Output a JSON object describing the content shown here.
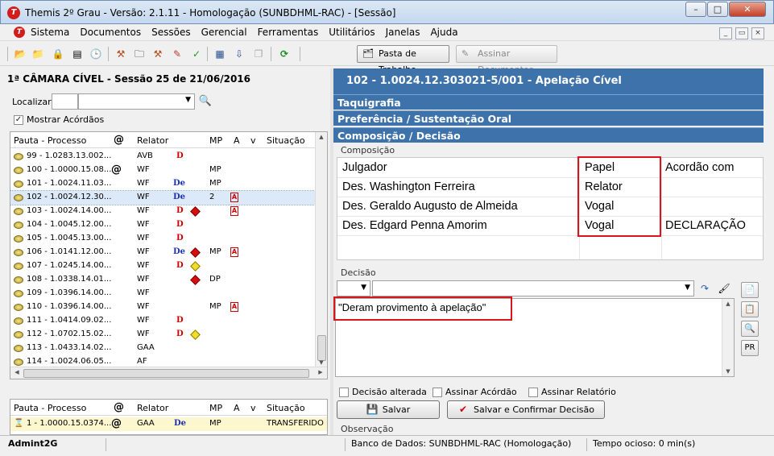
{
  "window": {
    "title": "Themis 2º Grau - Versão: 2.1.11 - Homologação (SUNBDHML-RAC) - [Sessão]",
    "logo_letter": "T",
    "controls": {
      "minimize": "–",
      "maximize": "□",
      "close": "✕"
    },
    "mdi_controls": {
      "minimize": "_",
      "restore": "▭",
      "close": "×"
    }
  },
  "menu": {
    "items": [
      "Sistema",
      "Documentos",
      "Sessões",
      "Gerencial",
      "Ferramentas",
      "Utilitários",
      "Janelas",
      "Ajuda"
    ]
  },
  "toolbar": {
    "pasta_label": "Pasta de Trabalho",
    "assinar_label": "Assinar Documentos",
    "icons": {
      "open_folder": "📂",
      "folder": "📁",
      "lock": "🔒",
      "notebook": "▤",
      "clock": "🕒",
      "gavel": "⚒",
      "folder2": "🗀",
      "gavel2": "⚒",
      "pencil": "✎",
      "check": "✓",
      "list": "▦",
      "download": "⇩",
      "copy": "❐",
      "refresh": "⟳",
      "pasta": "🗂",
      "pen": "✎"
    }
  },
  "left": {
    "session_title": "1ª CÂMARA CÍVEL - Sessão 25 de 21/06/2016",
    "localizar_label": "Localizar:",
    "search_icon": "🔍",
    "mostrar_label": "Mostrar Acórdãos",
    "mostrar_check": "✓",
    "columns": [
      "Pauta - Processo",
      "@",
      "Relator",
      "MP",
      "A",
      "v",
      "Situação"
    ],
    "rows": [
      {
        "proc": "99 - 1.0283.13.002...",
        "at": "",
        "rel": "AVB",
        "mk": "D",
        "flag": "",
        "mp": "",
        "a": ""
      },
      {
        "proc": "100 - 1.0000.15.08...",
        "at": "@",
        "rel": "WF",
        "mk": "",
        "flag": "",
        "mp": "MP",
        "a": ""
      },
      {
        "proc": "101 - 1.0024.11.03...",
        "at": "",
        "rel": "WF",
        "mk": "De",
        "flag": "",
        "mp": "MP",
        "a": ""
      },
      {
        "proc": "102 - 1.0024.12.30...",
        "at": "",
        "rel": "WF",
        "mk": "De",
        "flag": "",
        "mp": "2",
        "a": "A"
      },
      {
        "proc": "103 - 1.0024.14.00...",
        "at": "",
        "rel": "WF",
        "mk": "D",
        "flag": "red",
        "mp": "",
        "a": "A"
      },
      {
        "proc": "104 - 1.0045.12.00...",
        "at": "",
        "rel": "WF",
        "mk": "D",
        "flag": "",
        "mp": "",
        "a": ""
      },
      {
        "proc": "105 - 1.0045.13.00...",
        "at": "",
        "rel": "WF",
        "mk": "D",
        "flag": "",
        "mp": "",
        "a": ""
      },
      {
        "proc": "106 - 1.0141.12.00...",
        "at": "",
        "rel": "WF",
        "mk": "De",
        "flag": "red",
        "mp": "MP",
        "a": "A"
      },
      {
        "proc": "107 - 1.0245.14.00...",
        "at": "",
        "rel": "WF",
        "mk": "D",
        "flag": "yellow",
        "mp": "",
        "a": ""
      },
      {
        "proc": "108 - 1.0338.14.01...",
        "at": "",
        "rel": "WF",
        "mk": "",
        "flag": "red",
        "mp": "DP",
        "a": ""
      },
      {
        "proc": "109 - 1.0396.14.00...",
        "at": "",
        "rel": "WF",
        "mk": "",
        "flag": "",
        "mp": "",
        "a": ""
      },
      {
        "proc": "110 - 1.0396.14.00...",
        "at": "",
        "rel": "WF",
        "mk": "",
        "flag": "",
        "mp": "MP",
        "a": "A"
      },
      {
        "proc": "111 - 1.0414.09.02...",
        "at": "",
        "rel": "WF",
        "mk": "D",
        "flag": "",
        "mp": "",
        "a": ""
      },
      {
        "proc": "112 - 1.0702.15.02...",
        "at": "",
        "rel": "WF",
        "mk": "D",
        "flag": "yellow",
        "mp": "",
        "a": ""
      },
      {
        "proc": "113 - 1.0433.14.02...",
        "at": "",
        "rel": "GAA",
        "mk": "",
        "flag": "",
        "mp": "",
        "a": ""
      },
      {
        "proc": "114 - 1.0024.06.05...",
        "at": "",
        "rel": "AF",
        "mk": "",
        "flag": "",
        "mp": "",
        "a": ""
      }
    ],
    "selected_index": 3,
    "bottom_columns": [
      "Pauta - Processo",
      "@",
      "Relator",
      "MP",
      "A",
      "v",
      "Situação"
    ],
    "bottom_row": {
      "proc": "1 - 1.0000.15.0374...",
      "at": "@",
      "rel": "GAA",
      "mk": "De",
      "mp": "MP",
      "sit": "TRANSFERIDO"
    }
  },
  "right": {
    "header": "102   -   1.0024.12.303021-5/001 - Apelação Cível",
    "sections": [
      "Taquigrafia",
      "Preferência / Sustentação Oral",
      "Composição / Decisão"
    ],
    "composicao_label": "Composição",
    "comp_columns": [
      "Julgador",
      "Papel",
      "Acordão com"
    ],
    "comp_rows": [
      {
        "julgador": "Des. Washington Ferreira",
        "papel": "Relator",
        "acordao": ""
      },
      {
        "julgador": "Des. Geraldo Augusto de Almeida",
        "papel": "Vogal",
        "acordao": ""
      },
      {
        "julgador": "Des. Edgard Penna Amorim",
        "papel": "Vogal",
        "acordao": "DECLARAÇÃO"
      }
    ],
    "decisao_label": "Decisão",
    "decisao_text": "\"Deram provimento à apelação\"",
    "dec_icons": {
      "go": "↷",
      "brush": "🖌"
    },
    "side_buttons": {
      "b1": "📄",
      "b2": "📋",
      "b3": "🔍",
      "pr": "PR"
    },
    "checks": [
      "Decisão alterada",
      "Assinar Acórdão",
      "Assinar Relatório"
    ],
    "salvar_label": "Salvar",
    "salvar_icon": "💾",
    "confirmar_label": "Salvar e Confirmar Decisão",
    "confirmar_icon": "✔",
    "observacao_label": "Observação"
  },
  "status": {
    "user": "Admint2G",
    "db": "Banco de Dados: SUNBDHML-RAC (Homologação)",
    "idle": "Tempo ocioso: 0 min(s)"
  },
  "colors": {
    "header_blue": "#3e72ab",
    "highlight_red": "#d9141c",
    "selected_row": "#dbe9f8"
  }
}
